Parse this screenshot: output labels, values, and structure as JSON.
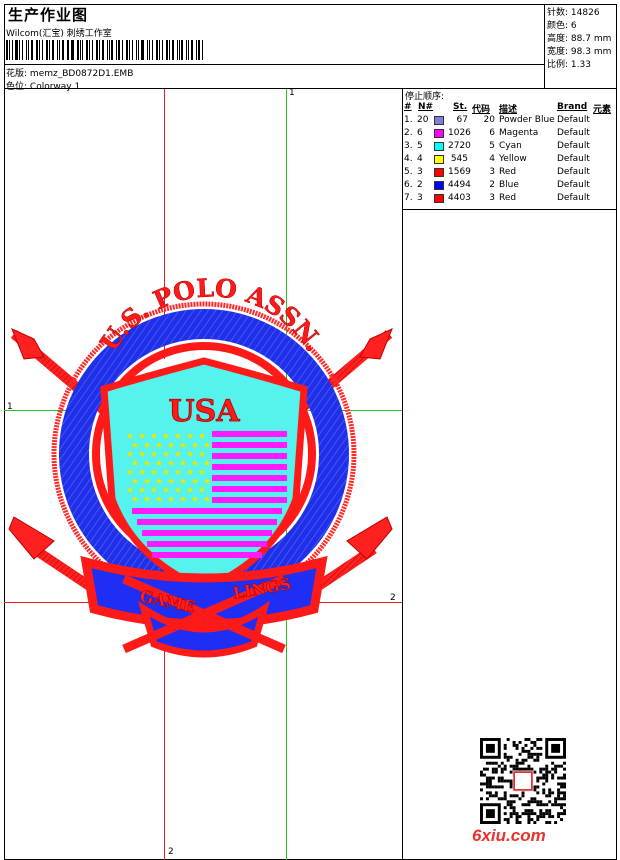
{
  "header": {
    "title": "生产作业图",
    "subtitle": "Wilcom(汇宝) 刺绣工作室",
    "design_label": "花版:",
    "design_value": "memz_BD0872D1.EMB",
    "colorway_label": "色位:",
    "colorway_value": "Colorway 1"
  },
  "stats": [
    {
      "label": "针数:",
      "value": "14826"
    },
    {
      "label": "颜色:",
      "value": "6"
    },
    {
      "label": "高度:",
      "value": "88.7 mm"
    },
    {
      "label": "宽度:",
      "value": "98.3 mm"
    },
    {
      "label": "比例:",
      "value": "1.33"
    }
  ],
  "stop_sequence": {
    "title": "停止顺序:",
    "columns": [
      "#",
      "N#",
      "St.",
      "代码",
      "描述",
      "Brand",
      "元素"
    ],
    "rows": [
      {
        "idx": "1.",
        "n": "20",
        "color": "#7f7fd6",
        "st": "67",
        "code": "20",
        "desc": "Powder Blue",
        "brand": "Default"
      },
      {
        "idx": "2.",
        "n": "6",
        "color": "#ff00ff",
        "st": "1026",
        "code": "6",
        "desc": "Magenta",
        "brand": "Default"
      },
      {
        "idx": "3.",
        "n": "5",
        "color": "#00ffff",
        "st": "2720",
        "code": "5",
        "desc": "Cyan",
        "brand": "Default"
      },
      {
        "idx": "4.",
        "n": "4",
        "color": "#ffff00",
        "st": "545",
        "code": "4",
        "desc": "Yellow",
        "brand": "Default"
      },
      {
        "idx": "5.",
        "n": "3",
        "color": "#ff0000",
        "st": "1569",
        "code": "3",
        "desc": "Red",
        "brand": "Default"
      },
      {
        "idx": "6.",
        "n": "2",
        "color": "#0000ff",
        "st": "4494",
        "code": "2",
        "desc": "Blue",
        "brand": "Default"
      },
      {
        "idx": "7.",
        "n": "3",
        "color": "#ff0000",
        "st": "4403",
        "code": "3",
        "desc": "Red",
        "brand": "Default"
      }
    ]
  },
  "guides": {
    "green_top": "1",
    "green_left": "1",
    "red_right": "2",
    "red_bottom": "2"
  },
  "design": {
    "arc_text": "U.S. POLO ASSN.",
    "flag_text": "USA",
    "banner_left": "GAME",
    "banner_right": "LINGS"
  },
  "watermark": "6xiu.com"
}
